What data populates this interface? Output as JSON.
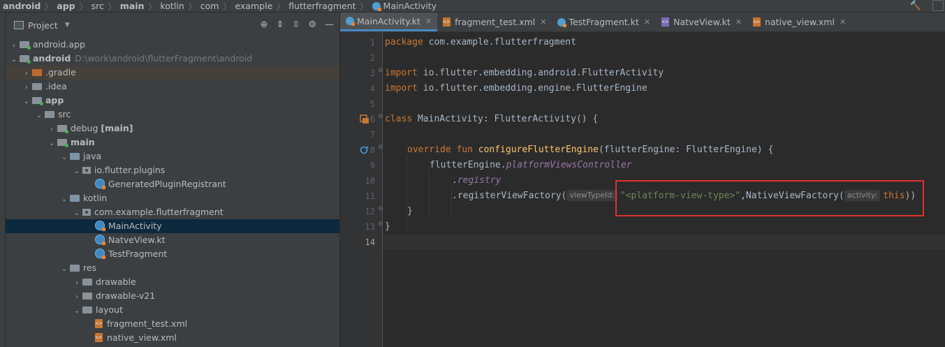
{
  "breadcrumb": [
    "android",
    "app",
    "src",
    "main",
    "kotlin",
    "com",
    "example",
    "flutterfragment",
    "MainActivity"
  ],
  "project_panel": {
    "title": "Project",
    "tree": [
      {
        "label": "android.app",
        "kind": "module"
      },
      {
        "label": "android",
        "kind": "module",
        "path": "D:\\work\\android\\flutterFragment\\android"
      },
      {
        "label": ".gradle",
        "kind": "folder"
      },
      {
        "label": ".idea",
        "kind": "folder"
      },
      {
        "label": "app",
        "kind": "module"
      },
      {
        "label": "src",
        "kind": "folder"
      },
      {
        "label": "debug",
        "suffix": "[main]",
        "kind": "folder"
      },
      {
        "label": "main",
        "kind": "folder"
      },
      {
        "label": "java",
        "kind": "folder"
      },
      {
        "label": "io.flutter.plugins",
        "kind": "package"
      },
      {
        "label": "GeneratedPluginRegistrant",
        "kind": "file"
      },
      {
        "label": "kotlin",
        "kind": "folder"
      },
      {
        "label": "com.example.flutterfragment",
        "kind": "package"
      },
      {
        "label": "MainActivity",
        "kind": "kotlin-file"
      },
      {
        "label": "NatveView.kt",
        "kind": "kotlin-file"
      },
      {
        "label": "TestFragment",
        "kind": "kotlin-file"
      },
      {
        "label": "res",
        "kind": "folder"
      },
      {
        "label": "drawable",
        "kind": "folder"
      },
      {
        "label": "drawable-v21",
        "kind": "folder"
      },
      {
        "label": "layout",
        "kind": "folder"
      },
      {
        "label": "fragment_test.xml",
        "kind": "xml-file"
      },
      {
        "label": "native_view.xml",
        "kind": "xml-file"
      }
    ]
  },
  "tabs": [
    {
      "label": "MainActivity.kt",
      "active": true
    },
    {
      "label": "fragment_test.xml",
      "active": false
    },
    {
      "label": "TestFragment.kt",
      "active": false
    },
    {
      "label": "NatveView.kt",
      "active": false
    },
    {
      "label": "native_view.xml",
      "active": false
    }
  ],
  "editor": {
    "line_numbers": [
      "1",
      "2",
      "3",
      "4",
      "5",
      "6",
      "7",
      "8",
      "9",
      "10",
      "11",
      "12",
      "13",
      "14"
    ],
    "current_line": "14",
    "code": {
      "l1_kw": "package",
      "l1_rest": " com.example.flutterfragment",
      "l3_kw": "import",
      "l3_rest": " io.flutter.embedding.android.FlutterActivity",
      "l4_kw": "import",
      "l4_rest": " io.flutter.embedding.engine.FlutterEngine",
      "l6_kw": "class",
      "l6_rest": " MainActivity: FlutterActivity() {",
      "l8_kw": "override fun ",
      "l8_fn": "configureFlutterEngine",
      "l8_rest": "(flutterEngine: FlutterEngine) {",
      "l9_a": "flutterEngine.",
      "l9_prop": "platformViewsController",
      "l10_a": ".",
      "l10_prop": "registry",
      "l11_a": ".registerViewFactory(",
      "l11_hint1": "viewTypeId:",
      "l11_str": "\"<platform-view-type>\"",
      "l11_b": ",NativeViewFactory(",
      "l11_hint2": "activity:",
      "l11_kw": "this",
      "l11_c": "))",
      "l12": "}",
      "l13": "}"
    }
  }
}
